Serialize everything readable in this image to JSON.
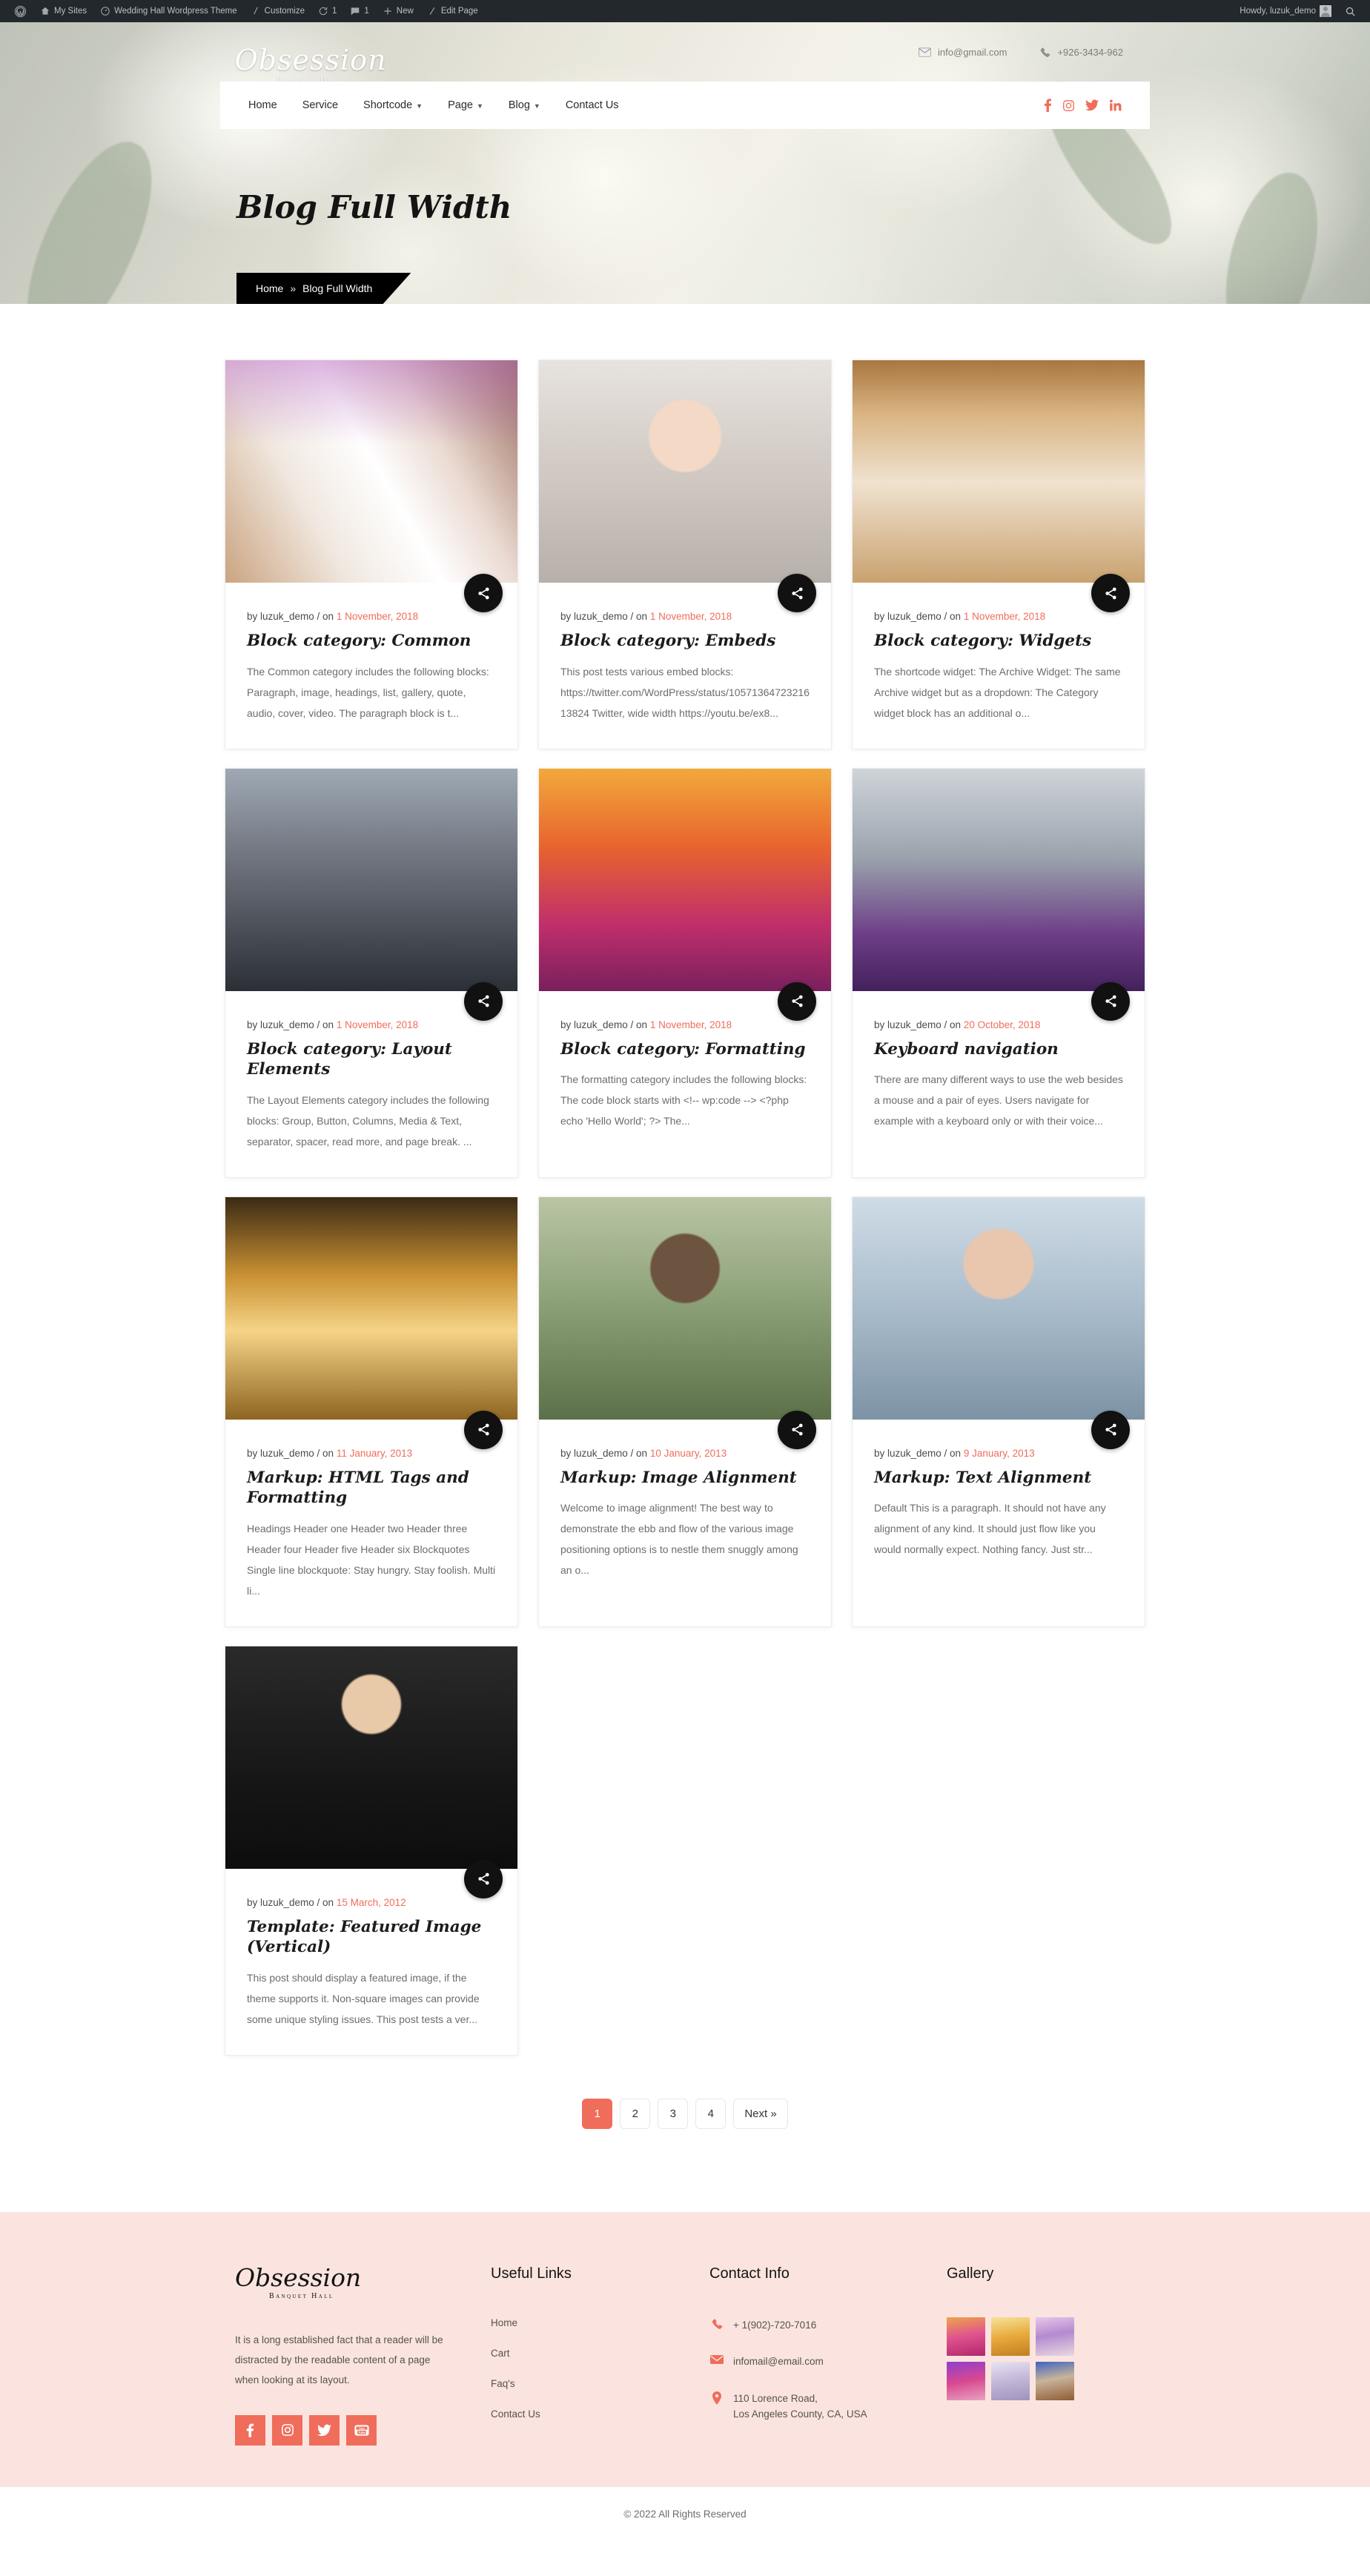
{
  "adminbar": {
    "items": [
      {
        "icon": "wordpress-icon",
        "label": ""
      },
      {
        "icon": "sites-icon",
        "label": "My Sites"
      },
      {
        "icon": "dashboard-icon",
        "label": "Wedding Hall Wordpress Theme"
      },
      {
        "icon": "pencil-icon",
        "label": "Customize"
      },
      {
        "icon": "updates-icon",
        "label": "1"
      },
      {
        "icon": "comment-icon",
        "label": "1"
      },
      {
        "icon": "plus-icon",
        "label": "New"
      },
      {
        "icon": "edit-icon",
        "label": "Edit Page"
      }
    ],
    "howdy": "Howdy, luzuk_demo",
    "avatar_name": "avatar",
    "search_icon": "search-icon"
  },
  "header": {
    "brand_main": "Obsession",
    "brand_sub": "Banquet Hall",
    "email": "info@gmail.com",
    "phone": "+926-3434-962",
    "email_icon": "envelope-icon",
    "phone_icon": "phone-icon",
    "nav": [
      {
        "label": "Home",
        "has_caret": false
      },
      {
        "label": "Service",
        "has_caret": false
      },
      {
        "label": "Shortcode",
        "has_caret": true
      },
      {
        "label": "Page",
        "has_caret": true
      },
      {
        "label": "Blog",
        "has_caret": true
      },
      {
        "label": "Contact Us",
        "has_caret": false
      }
    ],
    "socials": [
      "facebook-icon",
      "instagram-icon",
      "twitter-icon",
      "linkedin-icon"
    ]
  },
  "page": {
    "title": "Blog Full Width",
    "breadcrumb_home": "Home",
    "breadcrumb_sep": "»",
    "breadcrumb_current": "Blog Full Width"
  },
  "posts": [
    {
      "photo": "ph1",
      "by": "by luzuk_demo / on ",
      "date": "1 November, 2018",
      "title": "Block category: Common",
      "excerpt": "The Common category includes the following blocks: Paragraph, image, headings, list, gallery, quote, audio, cover, video. The paragraph block is t...",
      "share_icon": "share-icon"
    },
    {
      "photo": "ph2",
      "by": "by luzuk_demo / on ",
      "date": "1 November, 2018",
      "title": "Block category: Embeds",
      "excerpt": "This post tests various embed blocks: https://twitter.com/WordPress/status/1057136472321613824 Twitter,  wide width https://youtu.be/ex8...",
      "share_icon": "share-icon"
    },
    {
      "photo": "ph3",
      "by": "by luzuk_demo / on ",
      "date": "1 November, 2018",
      "title": "Block category: Widgets",
      "excerpt": "The shortcode widget: The Archive Widget: The same Archive widget but as a dropdown: The Category widget block has an additional o...",
      "share_icon": "share-icon"
    },
    {
      "photo": "ph4",
      "by": "by luzuk_demo / on ",
      "date": "1 November, 2018",
      "title": "Block category: Layout Elements",
      "excerpt": "The Layout Elements category includes the following blocks: Group, Button, Columns, Media & Text, separator, spacer, read more, and page break. ...",
      "share_icon": "share-icon"
    },
    {
      "photo": "ph5",
      "by": "by luzuk_demo / on ",
      "date": "1 November, 2018",
      "title": "Block category: Formatting",
      "excerpt": "The formatting category includes the following blocks: The code block starts with <!-- wp:code --> <?php echo 'Hello World'; ?> The...",
      "share_icon": "share-icon"
    },
    {
      "photo": "ph6",
      "by": "by luzuk_demo / on ",
      "date": "20 October, 2018",
      "title": "Keyboard navigation",
      "excerpt": "There are many different ways to use the web besides a mouse and a pair of eyes. Users navigate for example with a keyboard only or with their voice...",
      "share_icon": "share-icon"
    },
    {
      "photo": "ph7",
      "by": "by luzuk_demo / on ",
      "date": "11 January, 2013",
      "title": "Markup: HTML Tags and Formatting",
      "excerpt": "Headings Header one Header two Header three Header four Header five Header six Blockquotes Single line blockquote: Stay hungry. Stay foolish. Multi li...",
      "share_icon": "share-icon"
    },
    {
      "photo": "ph8",
      "by": "by luzuk_demo / on ",
      "date": "10 January, 2013",
      "title": "Markup: Image Alignment",
      "excerpt": "Welcome to image alignment! The best way to demonstrate the ebb and flow of the various image positioning options is to nestle them snuggly among an o...",
      "share_icon": "share-icon"
    },
    {
      "photo": "ph9",
      "by": "by luzuk_demo / on ",
      "date": "9 January, 2013",
      "title": "Markup: Text Alignment",
      "excerpt": "Default This is a paragraph. It should not have any alignment of any kind. It should just flow like you would normally expect. Nothing fancy. Just str...",
      "share_icon": "share-icon"
    },
    {
      "photo": "ph10",
      "by": "by luzuk_demo / on ",
      "date": "15 March, 2012",
      "title": "Template: Featured Image (Vertical)",
      "excerpt": "This post should display a featured image, if the theme supports it. Non-square images can provide some unique styling issues. This post tests a ver...",
      "share_icon": "share-icon"
    }
  ],
  "pagination": [
    {
      "label": "1",
      "active": true
    },
    {
      "label": "2",
      "active": false
    },
    {
      "label": "3",
      "active": false
    },
    {
      "label": "4",
      "active": false
    },
    {
      "label": "Next »",
      "active": false
    }
  ],
  "footer": {
    "brand_main": "Obsession",
    "brand_sub": "Banquet Hall",
    "about": "It is a long established fact that a reader will be distracted by the readable content of a page when looking at its layout.",
    "socials": [
      "facebook-icon",
      "instagram-icon",
      "twitter-icon",
      "youtube-icon"
    ],
    "useful_links_head": "Useful Links",
    "useful_links": [
      "Home",
      "Cart",
      "Faq's",
      "Contact Us"
    ],
    "contact_head": "Contact Info",
    "phone": "+ 1(902)-720-7016",
    "email": "infomail@email.com",
    "address_line1": "110 Lorence Road,",
    "address_line2": "Los Angeles County, CA, USA",
    "gallery_head": "Gallery",
    "gallery": [
      "g1",
      "g2",
      "g3",
      "g4",
      "g5",
      "g6"
    ],
    "copyright": "© 2022 All Rights Reserved"
  },
  "colors": {
    "accent": "#ef6d5a",
    "footer_bg": "#fbe4df",
    "adminbar_bg": "#23282d",
    "dark": "#111111"
  }
}
